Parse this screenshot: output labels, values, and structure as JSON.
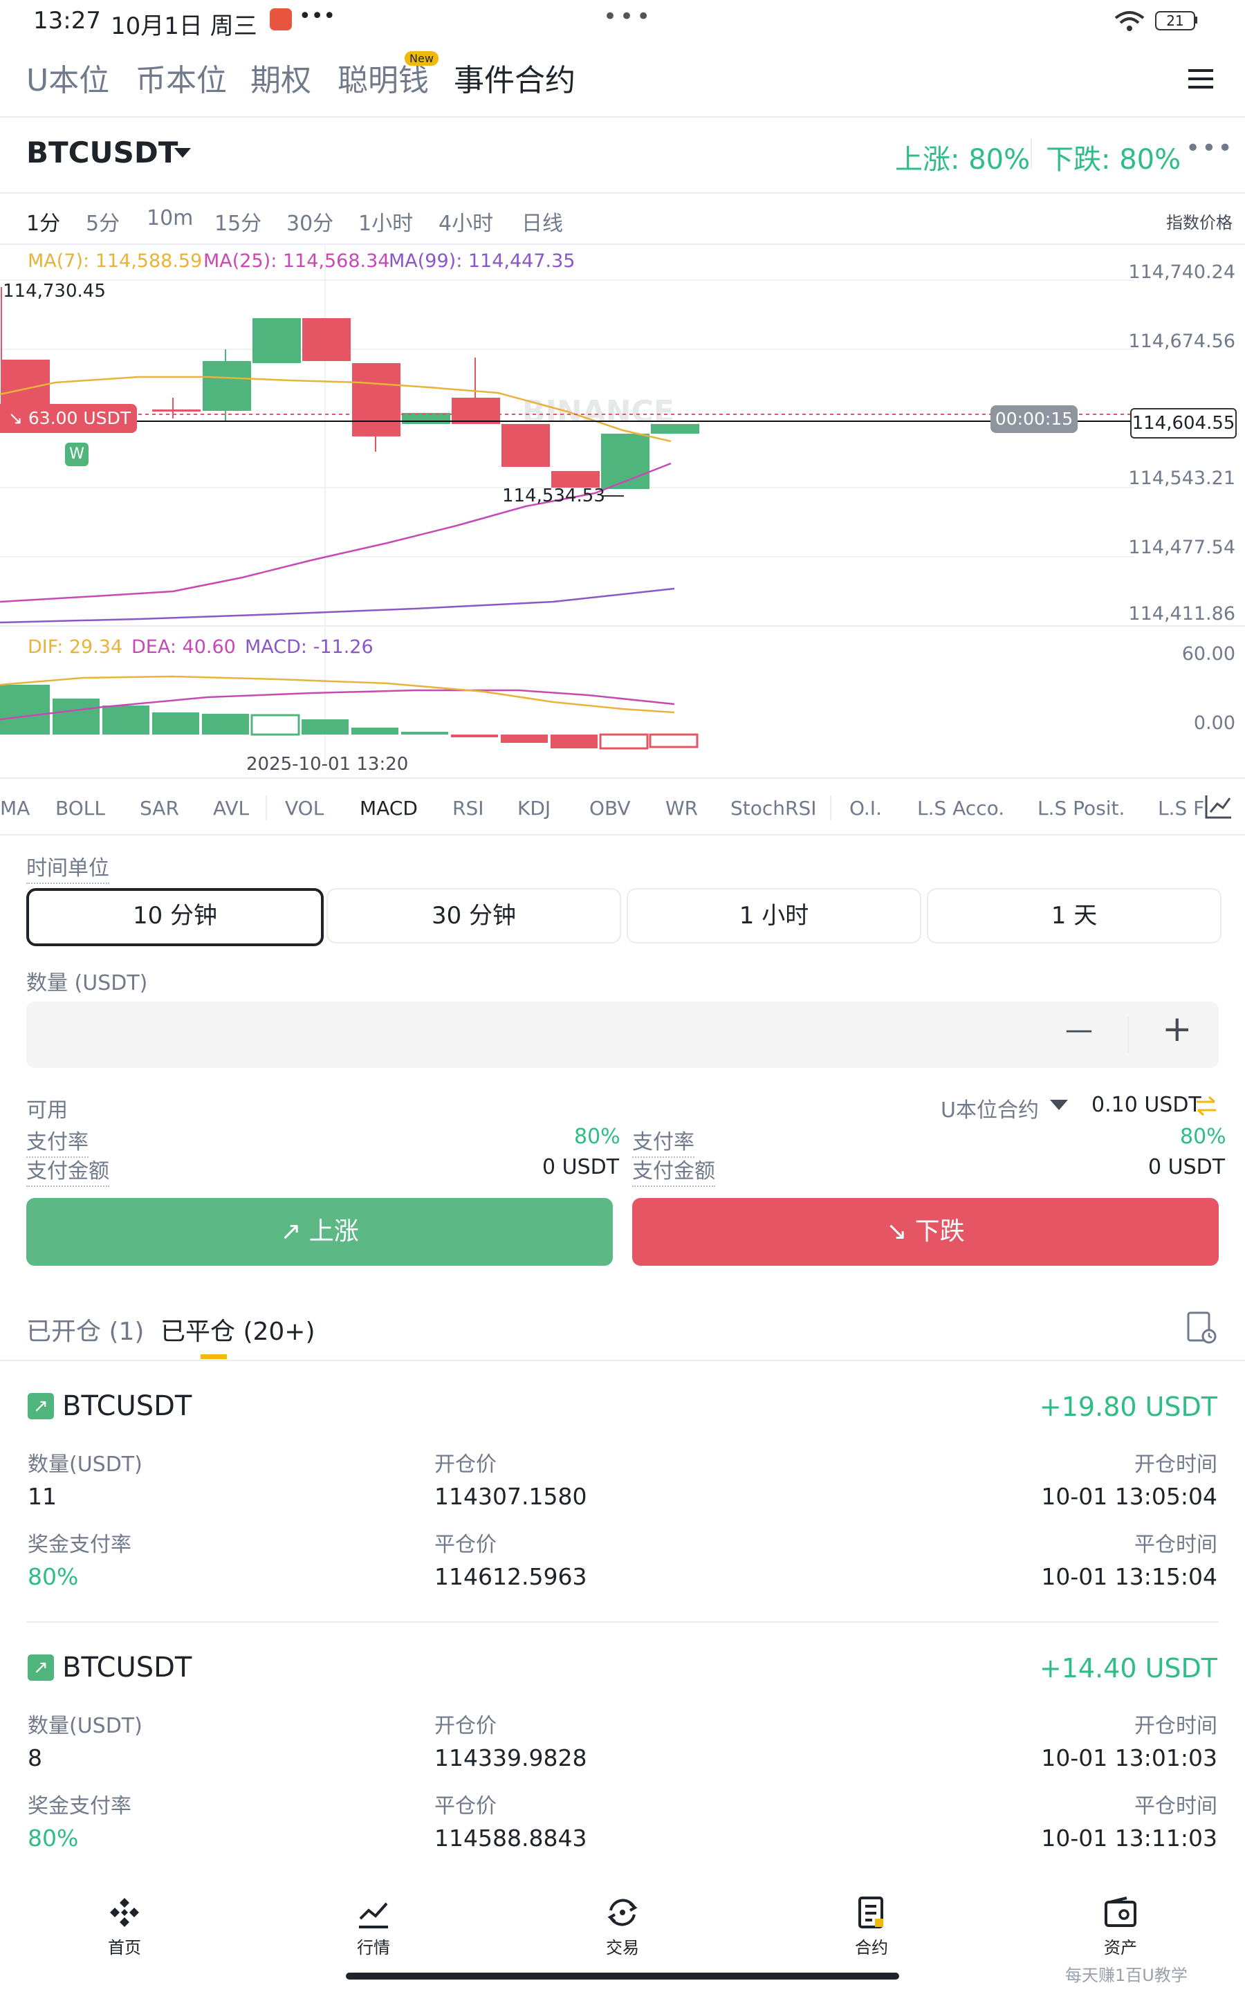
{
  "status_bar": {
    "time": "13:27",
    "date": "10月1日 周三",
    "dots": "•••",
    "battery": "21"
  },
  "top_tabs": [
    {
      "label": "U本位"
    },
    {
      "label": "币本位"
    },
    {
      "label": "期权"
    },
    {
      "label": "聪明钱",
      "badge": "New"
    },
    {
      "label": "事件合约"
    }
  ],
  "header": {
    "symbol": "BTCUSDT",
    "up_rate": "上涨: 80%",
    "down_rate": "下跌: 80%"
  },
  "intervals": [
    "1分",
    "5分",
    "10m",
    "15分",
    "30分",
    "1小时",
    "4小时",
    "日线"
  ],
  "index_price_label": "指数价格",
  "ma": {
    "ma7": "MA(7): 114,588.59",
    "ma25": "MA(25): 114,568.34",
    "ma99": "MA(99): 114,447.35"
  },
  "price_axis": [
    "114,740.24",
    "114,674.56",
    "114,543.21",
    "114,477.54",
    "114,411.86"
  ],
  "current_price": "114,604.55",
  "high_label": "114,730.45",
  "low_label": "114,534.53",
  "position_tag": "↘ 63.00 USDT",
  "countdown": "00:00:15",
  "win_badge": "W",
  "watermark": "BINANCE",
  "macd": {
    "dif": "DIF: 29.34",
    "dea": "DEA: 40.60",
    "macd": "MACD: -11.26",
    "axis_top": "60.00",
    "axis_zero": "0.00"
  },
  "x_axis_date": "2025-10-01 13:20",
  "indicators": [
    "MA",
    "BOLL",
    "SAR",
    "AVL",
    "VOL",
    "MACD",
    "RSI",
    "KDJ",
    "OBV",
    "WR",
    "StochRSI",
    "O.I.",
    "L.S Acco.",
    "L.S Posit.",
    "L.S F"
  ],
  "form": {
    "time_unit_label": "时间单位",
    "durations": [
      "10 分钟",
      "30 分钟",
      "1 小时",
      "1 天"
    ],
    "amount_label": "数量 (USDT)",
    "minus": "—",
    "plus": "+",
    "available_label": "可用",
    "contract_type": "U本位合约",
    "available_value": "0.10 USDT",
    "pay_rate_label": "支付率",
    "pay_amount_label": "支付金额",
    "left_rate": "80%",
    "left_amount": "0 USDT",
    "right_rate": "80%",
    "right_amount": "0 USDT",
    "up_button": "上涨",
    "down_button": "下跌"
  },
  "orders": {
    "open_tab": "已开仓 (1)",
    "closed_tab": "已平仓 (20+)",
    "items": [
      {
        "symbol": "BTCUSDT",
        "pnl": "+19.80 USDT",
        "qty_label": "数量(USDT)",
        "qty": "11",
        "open_price_label": "开仓价",
        "open_price": "114307.1580",
        "open_time_label": "开仓时间",
        "open_time": "10-01 13:05:04",
        "rate_label": "奖金支付率",
        "rate": "80%",
        "close_price_label": "平仓价",
        "close_price": "114612.5963",
        "close_time_label": "平仓时间",
        "close_time": "10-01 13:15:04"
      },
      {
        "symbol": "BTCUSDT",
        "pnl": "+14.40 USDT",
        "qty_label": "数量(USDT)",
        "qty": "8",
        "open_price_label": "开仓价",
        "open_price": "114339.9828",
        "open_time_label": "开仓时间",
        "open_time": "10-01 13:01:03",
        "rate_label": "奖金支付率",
        "rate": "80%",
        "close_price_label": "平仓价",
        "close_price": "114588.8843",
        "close_time_label": "平仓时间",
        "close_time": "10-01 13:11:03"
      }
    ]
  },
  "nav": [
    "首页",
    "行情",
    "交易",
    "合约",
    "资产"
  ],
  "watermark_footer": "每天赚1百U教学"
}
